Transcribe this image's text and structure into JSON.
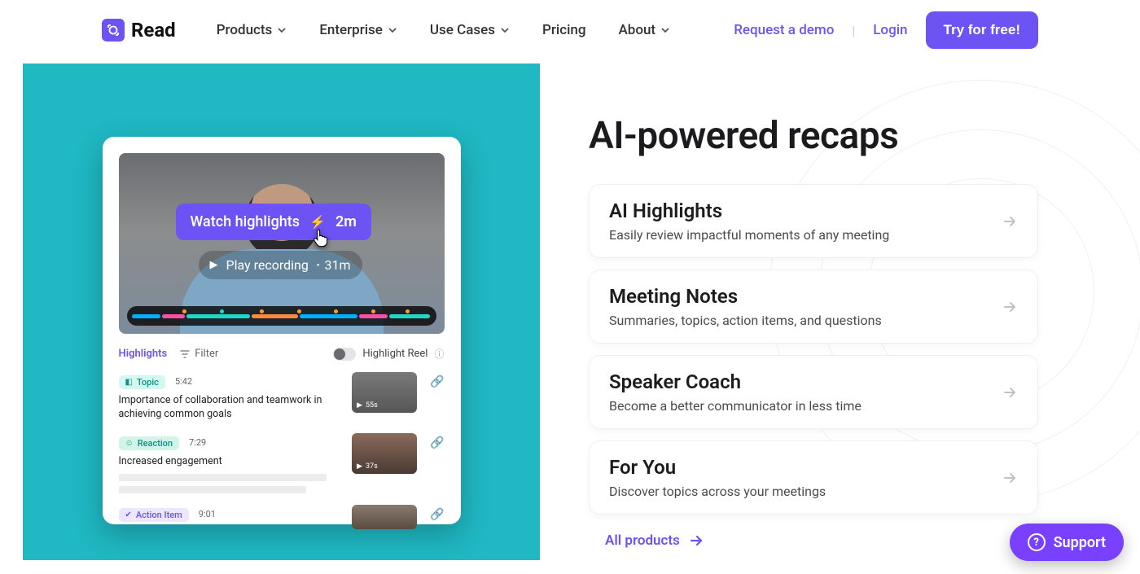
{
  "brand": {
    "name": "Read"
  },
  "nav": {
    "items": [
      {
        "label": "Products",
        "has_menu": true
      },
      {
        "label": "Enterprise",
        "has_menu": true
      },
      {
        "label": "Use Cases",
        "has_menu": true
      },
      {
        "label": "Pricing",
        "has_menu": false
      },
      {
        "label": "About",
        "has_menu": true
      }
    ],
    "demo": "Request a demo",
    "login": "Login",
    "cta": "Try for free!"
  },
  "mock": {
    "watch_label": "Watch highlights",
    "watch_duration": "2m",
    "play_label": "Play recording",
    "play_duration": "31m",
    "tabs_highlights": "Highlights",
    "filter_label": "Filter",
    "reel_label": "Highlight Reel",
    "items": [
      {
        "badge": "Topic",
        "time": "5:42",
        "text": "Importance of collaboration and teamwork in achieving common goals",
        "thumb_dur": "55s"
      },
      {
        "badge": "Reaction",
        "time": "7:29",
        "text": "Increased engagement",
        "thumb_dur": "37s"
      },
      {
        "badge": "Action Item",
        "time": "9:01",
        "text": "",
        "thumb_dur": ""
      }
    ]
  },
  "section": {
    "headline": "AI-powered recaps",
    "cards": [
      {
        "title": "AI Highlights",
        "desc": "Easily review impactful moments of any meeting"
      },
      {
        "title": "Meeting Notes",
        "desc": "Summaries, topics, action items, and questions"
      },
      {
        "title": "Speaker Coach",
        "desc": "Become a better communicator in less time"
      },
      {
        "title": "For You",
        "desc": "Discover topics across your meetings"
      }
    ],
    "all_products": "All products"
  },
  "support": {
    "label": "Support"
  }
}
